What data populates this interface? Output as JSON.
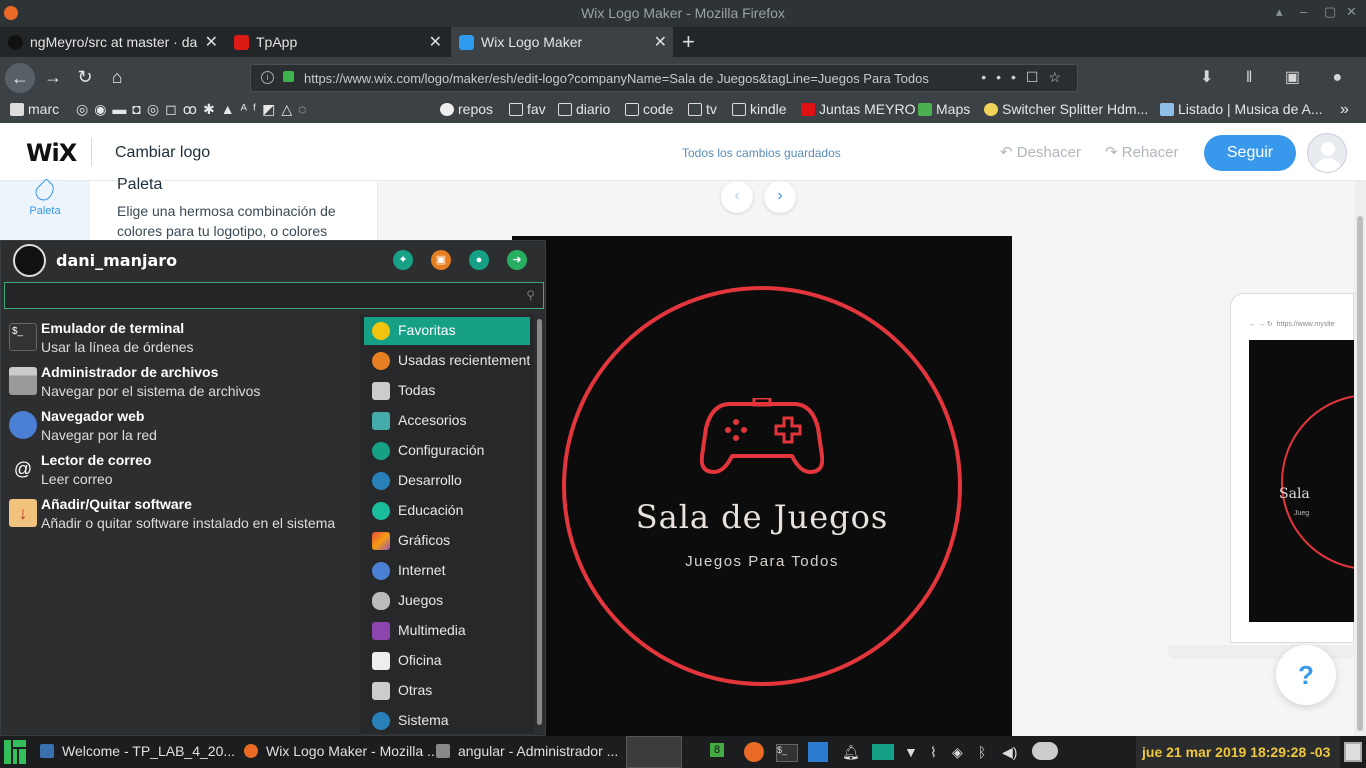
{
  "window": {
    "title": "Wix Logo Maker - Mozilla Firefox"
  },
  "tabs": [
    {
      "label": "ngMeyro/src at master · da",
      "active": false
    },
    {
      "label": "TpApp",
      "active": false
    },
    {
      "label": "Wix Logo Maker",
      "active": true
    }
  ],
  "url": "https://www.wix.com/logo/maker/esh/edit-logo?companyName=Sala de Juegos&tagLine=Juegos Para Todos",
  "bookmarks": [
    "marc",
    "repos",
    "fav",
    "diario",
    "code",
    "tv",
    "kindle",
    "Juntas MEYRO",
    "Maps",
    "Switcher Splitter Hdm...",
    "Listado | Musica de A..."
  ],
  "wix": {
    "title": "Cambiar logo",
    "saved_status": "Todos los cambios guardados",
    "undo": "Deshacer",
    "redo": "Rehacer",
    "follow": "Seguir",
    "side_tab": "Paleta",
    "panel_title": "Paleta",
    "panel_desc": "Elige una hermosa combinación de colores para tu logotipo, o colores",
    "logo": {
      "name": "Sala de Juegos",
      "tagline": "Juegos Para Todos",
      "accent": "#e3363c",
      "background": "#0c0c0c"
    },
    "mockup_url": "https://www.mysite",
    "mockup_name": "Sala",
    "mockup_tag": "Jueg",
    "help": "?"
  },
  "menu": {
    "user": "dani_manjaro",
    "search_placeholder": "",
    "favorites": [
      {
        "name": "Emulador de terminal",
        "desc": "Usar la línea de órdenes"
      },
      {
        "name": "Administrador de archivos",
        "desc": "Navegar por el sistema de archivos"
      },
      {
        "name": "Navegador web",
        "desc": "Navegar por la red"
      },
      {
        "name": "Lector de correo",
        "desc": "Leer correo"
      },
      {
        "name": "Añadir/Quitar software",
        "desc": "Añadir o quitar software instalado en el sistema"
      }
    ],
    "categories": [
      "Favoritas",
      "Usadas recientemente",
      "Todas",
      "Accesorios",
      "Configuración",
      "Desarrollo",
      "Educación",
      "Gráficos",
      "Internet",
      "Juegos",
      "Multimedia",
      "Oficina",
      "Otras",
      "Sistema"
    ]
  },
  "taskbar": {
    "tasks": [
      "Welcome - TP_LAB_4_20...",
      "Wix Logo Maker - Mozilla ...",
      "angular - Administrador ..."
    ],
    "badge": "8",
    "clock": "jue 21 mar 2019 18:29:28 -03"
  }
}
